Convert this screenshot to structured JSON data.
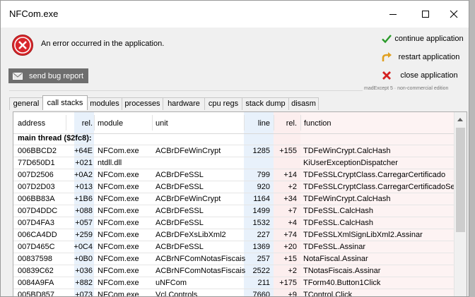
{
  "window": {
    "title": "NFCom.exe"
  },
  "error": {
    "message": "An error occurred in the application."
  },
  "buttons": {
    "bug_report": "send bug report",
    "continue": "continue application",
    "restart": "restart application",
    "close": "close application"
  },
  "edition": "madExcept 5 · non-commercial edition",
  "tabs": [
    "general",
    "call stacks",
    "modules",
    "processes",
    "hardware",
    "cpu regs",
    "stack dump",
    "disasm"
  ],
  "active_tab": "call stacks",
  "table": {
    "headers": {
      "address": "address",
      "rel1": "rel.",
      "module": "module",
      "unit": "unit",
      "line": "line",
      "rel2": "rel.",
      "function": "function"
    },
    "thread": "main thread ($2fc8):",
    "rows": [
      {
        "address": "006BBCD2",
        "rel1": "+64E",
        "module": "NFCom.exe",
        "unit": "ACBrDFeWinCrypt",
        "line": "1285",
        "rel2": "+155",
        "function": "TDFeWinCrypt.CalcHash"
      },
      {
        "address": "77D650D1",
        "rel1": "+021",
        "module": "ntdll.dll",
        "unit": "",
        "line": "",
        "rel2": "",
        "function": "KiUserExceptionDispatcher"
      },
      {
        "address": "007D2506",
        "rel1": "+0A2",
        "module": "NFCom.exe",
        "unit": "ACBrDFeSSL",
        "line": "799",
        "rel2": "+14",
        "function": "TDFeSSLCryptClass.CarregarCertificado"
      },
      {
        "address": "007D2D03",
        "rel1": "+013",
        "module": "NFCom.exe",
        "unit": "ACBrDFeSSL",
        "line": "920",
        "rel2": "+2",
        "function": "TDFeSSLCryptClass.CarregarCertificadoSeNe"
      },
      {
        "address": "006BB83A",
        "rel1": "+1B6",
        "module": "NFCom.exe",
        "unit": "ACBrDFeWinCrypt",
        "line": "1164",
        "rel2": "+34",
        "function": "TDFeWinCrypt.CalcHash"
      },
      {
        "address": "007D4DDC",
        "rel1": "+088",
        "module": "NFCom.exe",
        "unit": "ACBrDFeSSL",
        "line": "1499",
        "rel2": "+7",
        "function": "TDFeSSL.CalcHash"
      },
      {
        "address": "007D4FA3",
        "rel1": "+057",
        "module": "NFCom.exe",
        "unit": "ACBrDFeSSL",
        "line": "1532",
        "rel2": "+4",
        "function": "TDFeSSL.CalcHash"
      },
      {
        "address": "006CA4DD",
        "rel1": "+259",
        "module": "NFCom.exe",
        "unit": "ACBrDFeXsLibXml2",
        "line": "227",
        "rel2": "+74",
        "function": "TDFeSSLXmlSignLibXml2.Assinar"
      },
      {
        "address": "007D465C",
        "rel1": "+0C4",
        "module": "NFCom.exe",
        "unit": "ACBrDFeSSL",
        "line": "1369",
        "rel2": "+20",
        "function": "TDFeSSL.Assinar"
      },
      {
        "address": "00837598",
        "rel1": "+0B0",
        "module": "NFCom.exe",
        "unit": "ACBrNFComNotasFiscais",
        "line": "257",
        "rel2": "+15",
        "function": "NotaFiscal.Assinar"
      },
      {
        "address": "00839C62",
        "rel1": "+036",
        "module": "NFCom.exe",
        "unit": "ACBrNFComNotasFiscais",
        "line": "2522",
        "rel2": "+2",
        "function": "TNotasFiscais.Assinar"
      },
      {
        "address": "0084A9FA",
        "rel1": "+882",
        "module": "NFCom.exe",
        "unit": "uNFCom",
        "line": "211",
        "rel2": "+175",
        "function": "TForm40.Button1Click"
      },
      {
        "address": "005BD857",
        "rel1": "+073",
        "module": "NFCom.exe",
        "unit": "Vcl.Controls",
        "line": "7660",
        "rel2": "+9",
        "function": "TControl.Click"
      }
    ]
  },
  "colors": {
    "col_blue": "#e8f1fb",
    "col_pink": "#fceeee",
    "error_red": "#d8262b",
    "check_green": "#2a9a2a",
    "close_red": "#d42020",
    "restart_orange": "#e0a020"
  },
  "icons": {
    "error": "error-circle-icon",
    "bug": "mail-icon",
    "continue": "check-icon",
    "restart": "restart-arrow-icon",
    "close": "red-x-icon"
  }
}
